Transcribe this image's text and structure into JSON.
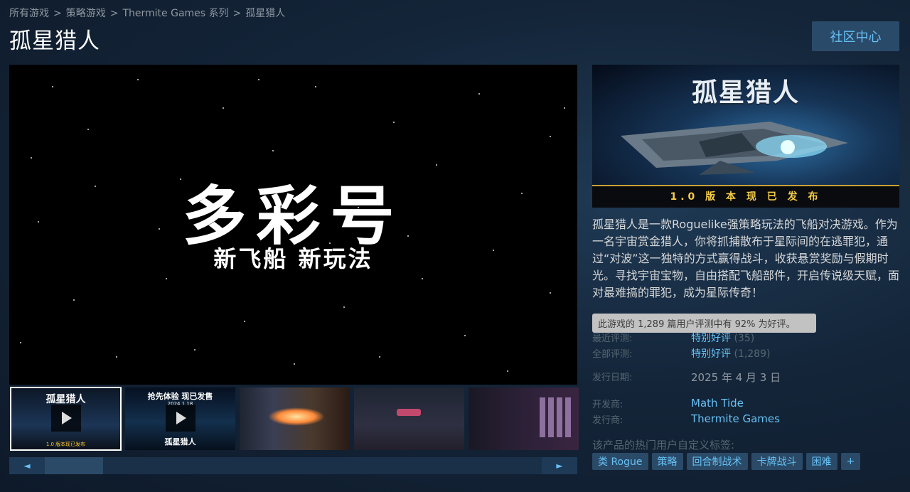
{
  "breadcrumb": [
    "所有游戏",
    "策略游戏",
    "Thermite Games 系列",
    "孤星猎人"
  ],
  "breadcrumb_sep": ">",
  "title": "孤星猎人",
  "community_button": "社区中心",
  "media": {
    "headline": "多彩号",
    "subhead": "新飞船 新玩法"
  },
  "thumbnails": [
    {
      "title": "孤星猎人",
      "footer": "1.0 版本现已发布",
      "video": true,
      "selected": true
    },
    {
      "title": "抢先体验 现已发售",
      "date": "2024.1.18",
      "subtitle": "孤星猎人",
      "video": true,
      "selected": false
    },
    {
      "video": false,
      "selected": false
    },
    {
      "video": false,
      "selected": false
    },
    {
      "video": false,
      "selected": false
    }
  ],
  "scroll": {
    "left": "◄",
    "right": "►"
  },
  "capsule": {
    "title": "孤星猎人",
    "banner": "1.0 版 本 现 已 发 布"
  },
  "description": "孤星猎人是一款Roguelike强策略玩法的飞船对决游戏。作为一名宇宙赏金猎人，你将抓捕散布于星际间的在逃罪犯，通过“对波”这一独特的方式赢得战斗，收获悬赏奖励与假期时光。寻找宇宙宝物，自由搭配飞船部件，开启传说级天赋，面对最难搞的罪犯，成为星际传奇！",
  "tooltip": "此游戏的 1,289 篇用户评测中有 92% 为好评。",
  "reviews": {
    "recent_label": "最近评测:",
    "recent_value": "特别好评",
    "recent_count": "(35)",
    "all_label": "全部评测:",
    "all_value": "特别好评",
    "all_count": "(1,289)"
  },
  "release": {
    "label": "发行日期:",
    "value": "2025 年 4 月 3 日"
  },
  "developer": {
    "label": "开发商:",
    "value": "Math Tide"
  },
  "publisher": {
    "label": "发行商:",
    "value": "Thermite Games"
  },
  "tags_label": "该产品的热门用户自定义标签:",
  "tags": [
    "类 Rogue",
    "策略",
    "回合制战术",
    "卡牌战斗",
    "困难",
    "+"
  ]
}
